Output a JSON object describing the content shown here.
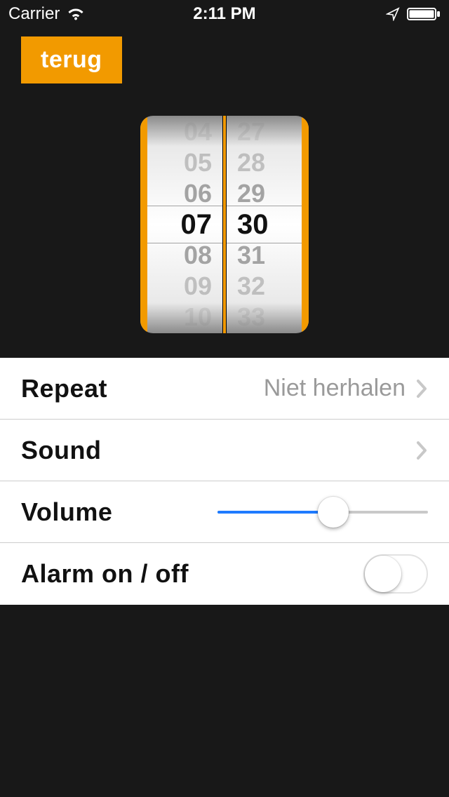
{
  "status_bar": {
    "carrier": "Carrier",
    "time": "2:11 PM"
  },
  "nav": {
    "back_label": "terug"
  },
  "picker": {
    "hours": [
      "04",
      "05",
      "06",
      "07",
      "08",
      "09",
      "10"
    ],
    "minutes": [
      "27",
      "28",
      "29",
      "30",
      "31",
      "32",
      "33"
    ],
    "selected_hour": "07",
    "selected_minute": "30"
  },
  "settings": {
    "repeat": {
      "label": "Repeat",
      "value": "Niet herhalen"
    },
    "sound": {
      "label": "Sound"
    },
    "volume": {
      "label": "Volume",
      "value_percent": 55
    },
    "alarm": {
      "label": "Alarm on / off",
      "on": false
    }
  },
  "colors": {
    "accent": "#f29a00",
    "slider_active": "#1e7bff"
  }
}
